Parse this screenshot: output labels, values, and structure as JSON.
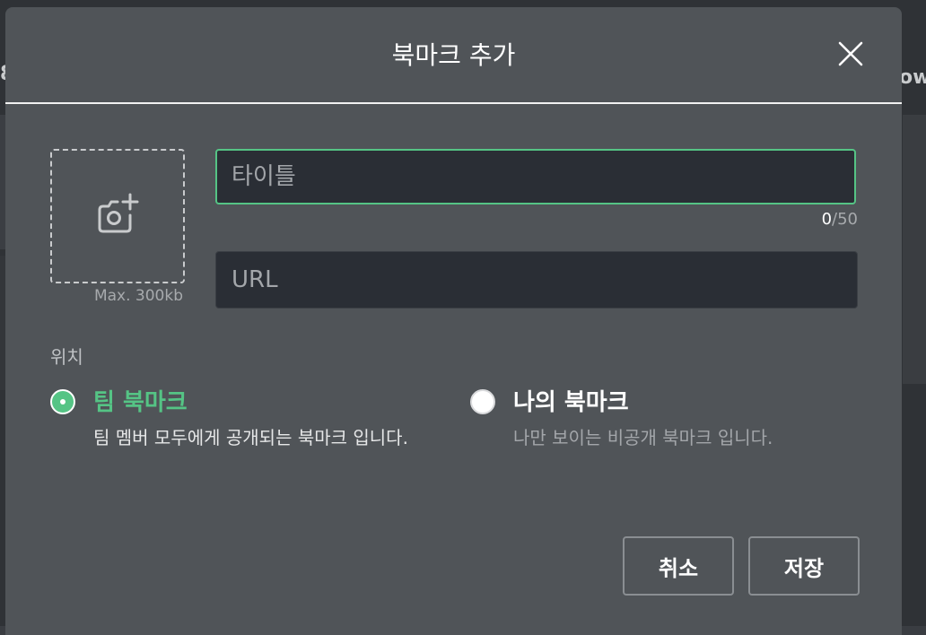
{
  "background": {
    "left_fragment": "8",
    "right_fragment": "ow"
  },
  "dialog": {
    "title": "북마크 추가",
    "close_icon": "close-x-icon"
  },
  "image_upload": {
    "icon": "camera-add-icon",
    "max_size": "Max. 300kb"
  },
  "title_field": {
    "placeholder": "타이틀",
    "value": "",
    "count_current": "0",
    "count_max": "/50"
  },
  "url_field": {
    "placeholder": "URL",
    "value": ""
  },
  "location": {
    "label": "위치",
    "options": [
      {
        "title": "팀 북마크",
        "description": "팀 멤버 모두에게 공개되는 북마크 입니다.",
        "selected": true
      },
      {
        "title": "나의 북마크",
        "description": "나만 보이는 비공개 북마크 입니다.",
        "selected": false
      }
    ]
  },
  "buttons": {
    "cancel": "취소",
    "save": "저장"
  },
  "colors": {
    "accent": "#55c485",
    "modal_bg": "#505458",
    "input_bg": "#2a2e35"
  }
}
